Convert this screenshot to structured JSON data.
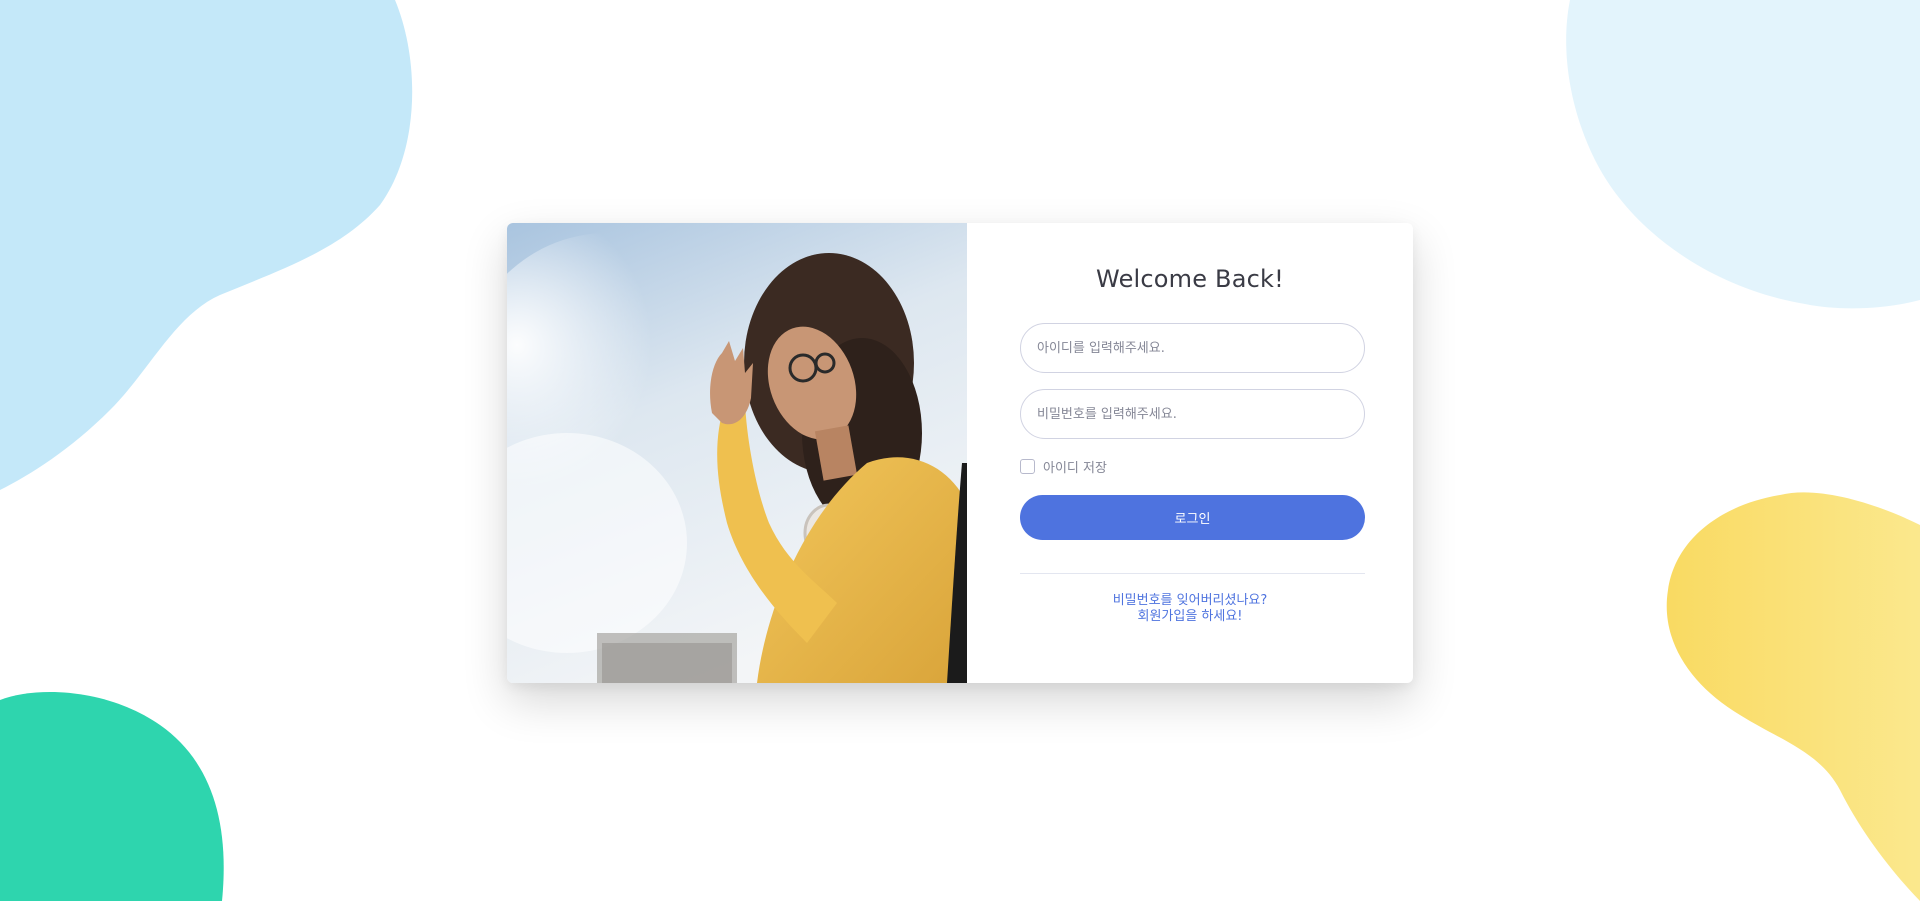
{
  "login": {
    "title": "Welcome Back!",
    "id_placeholder": "아이디를 입력해주세요.",
    "pw_placeholder": "비밀번호를 입력해주세요.",
    "remember_label": "아이디 저장",
    "login_button": "로그인",
    "forgot_link": "비밀번호를 잊어버리셨나요?",
    "signup_link": "회원가입을 하세요!"
  },
  "colors": {
    "primary": "#4e73df",
    "blob_blue": "#c4e8f9",
    "blob_light_blue": "#e3f4fc",
    "blob_green": "#2ed5ae",
    "blob_yellow": "#f9dd6f"
  },
  "icons": {
    "remember_checkbox": "checkbox-empty"
  }
}
